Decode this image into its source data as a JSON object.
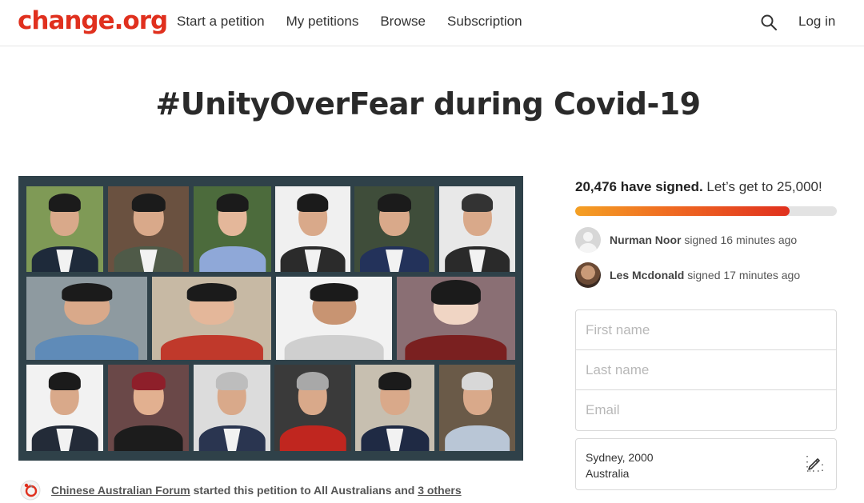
{
  "header": {
    "logo": "change.org",
    "nav": [
      "Start a petition",
      "My petitions",
      "Browse",
      "Subscription"
    ],
    "login": "Log in",
    "search_icon": "search-icon"
  },
  "petition": {
    "title": "#UnityOverFear during Covid-19",
    "image_alt": "Collage of prominent Chinese Australians",
    "signed_count": "20,476 have signed.",
    "goal_text": " Let’s get to 25,000!",
    "progress": 0.82
  },
  "recent_signers": [
    {
      "name": "Nurman Noor",
      "action": " signed 16 minutes ago",
      "avatar": "default-avatar"
    },
    {
      "name": "Les Mcdonald",
      "action": " signed 17 minutes ago",
      "avatar": "photo-avatar"
    }
  ],
  "form": {
    "first_name_placeholder": "First name",
    "last_name_placeholder": "Last name",
    "email_placeholder": "Email",
    "location_line1": "Sydney, 2000",
    "location_line2": "Australia"
  },
  "starter": {
    "org": "Chinese Australian Forum",
    "middle": " started this petition to All Australians and ",
    "others": "3 others"
  },
  "colors": {
    "brand": "#e0301e",
    "progress_start": "#f4a024",
    "progress_end": "#e0301e"
  }
}
